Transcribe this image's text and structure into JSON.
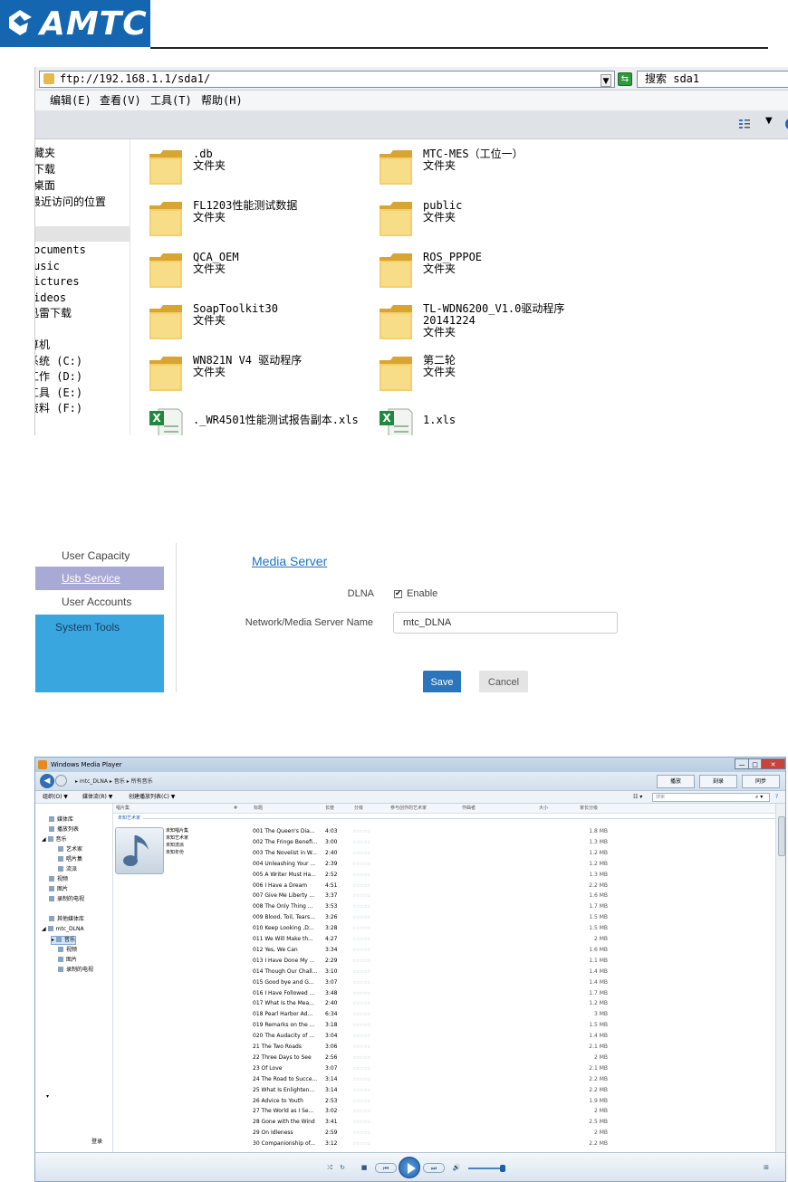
{
  "header": {
    "logo_text": "AMTC"
  },
  "ftp": {
    "address": "ftp://192.168.1.1/sda1/",
    "search": "搜索 sda1",
    "menus": [
      "编辑(E)",
      "查看(V)",
      "工具(T)",
      "帮助(H)"
    ],
    "nav_items": [
      "藏夹",
      "下载",
      "桌面",
      "最近访问的位置",
      "ocuments",
      "usic",
      "ictures",
      "ideos",
      "迅雷下载",
      "算机",
      "系统 (C:)",
      "工作 (D:)",
      "工具 (E:)",
      "资料 (F:)"
    ],
    "files": [
      {
        "name": ".db",
        "type": "文件夹",
        "kind": "folder"
      },
      {
        "name": "MTC-MES（工位一）",
        "type": "文件夹",
        "kind": "folder"
      },
      {
        "name": "FL1203性能测试数据",
        "type": "文件夹",
        "kind": "folder"
      },
      {
        "name": "public",
        "type": "文件夹",
        "kind": "folder"
      },
      {
        "name": "QCA_OEM",
        "type": "文件夹",
        "kind": "folder"
      },
      {
        "name": "ROS_PPPOE",
        "type": "文件夹",
        "kind": "folder"
      },
      {
        "name": "SoapToolkit30",
        "type": "文件夹",
        "kind": "folder"
      },
      {
        "name": "TL-WDN6200_V1.0驱动程序",
        "name2": "20141224",
        "type": "文件夹",
        "kind": "folder"
      },
      {
        "name": "WN821N V4 驱动程序",
        "type": "文件夹",
        "kind": "folder"
      },
      {
        "name": "第二轮",
        "type": "文件夹",
        "kind": "folder"
      },
      {
        "name": "._WR4501性能测试报告副本.xls",
        "type": "",
        "kind": "xls"
      },
      {
        "name": "1.xls",
        "type": "",
        "kind": "xls"
      }
    ]
  },
  "router": {
    "sidebar": [
      "User Capacity",
      "Usb Service",
      "User Accounts",
      "System Tools"
    ],
    "title": "Media Server",
    "dlna_label": "DLNA",
    "dlna_enabled": true,
    "enable_label": "Enable",
    "name_label": "Network/Media Server Name",
    "name_value": "mtc_DLNA",
    "save": "Save",
    "cancel": "Cancel",
    "colors": {
      "accent": "#2a75bc",
      "sidebar_active": "#a9a9d6",
      "sidebar_tools": "#3aa6e0"
    }
  },
  "wmp": {
    "title": "Windows Media Player",
    "window_buttons": [
      "minimize-icon",
      "maximize-icon",
      "close-icon"
    ],
    "breadcrumb": "▸  mtc_DLNA  ▸  音乐  ▸  所有音乐",
    "tabs": [
      "播放",
      "刻录",
      "同步"
    ],
    "commands": [
      "组织(O) ▼",
      "媒体流(R) ▼",
      "创建播放列表(C) ▼"
    ],
    "search_placeholder": "搜索",
    "columns": [
      "唱片集",
      "#",
      "标题",
      "长度",
      "分级",
      "参与创作的艺术家",
      "作曲者",
      "大小",
      "家长分级"
    ],
    "artist_group": "未知艺术家",
    "album_meta": [
      "未知唱片集",
      "未知艺术家",
      "未知流派",
      "未知年份"
    ],
    "left_nav": [
      "媒体库",
      "播放列表",
      "音乐",
      "艺术家",
      "唱片集",
      "流派",
      "视频",
      "图片",
      "录制的电视",
      "其他媒体库",
      "mtc_DLNA",
      "音乐",
      "视频",
      "图片",
      "录制的电视"
    ],
    "login": "登录",
    "rating_text": "☆☆☆☆☆",
    "tracks": [
      {
        "title": "001 The Queen's Dia...",
        "length": "4:03",
        "size": "1.8 MB"
      },
      {
        "title": "002 The Fringe Benefi...",
        "length": "3:00",
        "size": "1.3 MB"
      },
      {
        "title": "003 The Novelist in W...",
        "length": "2:40",
        "size": "1.2 MB"
      },
      {
        "title": "004 Unleashing Your ...",
        "length": "2:39",
        "size": "1.2 MB"
      },
      {
        "title": "005 A Writer Must Ha...",
        "length": "2:52",
        "size": "1.3 MB"
      },
      {
        "title": "006 I Have a Dream",
        "length": "4:51",
        "size": "2.2 MB"
      },
      {
        "title": "007 Give Me Liberty ...",
        "length": "3:37",
        "size": "1.6 MB"
      },
      {
        "title": "008 The Only Thing ...",
        "length": "3:53",
        "size": "1.7 MB"
      },
      {
        "title": "009 Blood, Toil, Tears...",
        "length": "3:26",
        "size": "1.5 MB"
      },
      {
        "title": "010 Keep Looking ,D...",
        "length": "3:28",
        "size": "1.5 MB"
      },
      {
        "title": "011 We Will Make th...",
        "length": "4:27",
        "size": "2 MB"
      },
      {
        "title": "012 Yes, We Can",
        "length": "3:34",
        "size": "1.6 MB"
      },
      {
        "title": "013 I Have Done My ...",
        "length": "2:29",
        "size": "1.1 MB"
      },
      {
        "title": "014 Though Our Chall...",
        "length": "3:10",
        "size": "1.4 MB"
      },
      {
        "title": "015 Good bye and G...",
        "length": "3:07",
        "size": "1.4 MB"
      },
      {
        "title": "016 I Have Followed ...",
        "length": "3:48",
        "size": "1.7 MB"
      },
      {
        "title": "017 What Is the Mea...",
        "length": "2:40",
        "size": "1.2 MB"
      },
      {
        "title": "018 Pearl Harbor Ad...",
        "length": "6:34",
        "size": "3 MB"
      },
      {
        "title": "019 Remarks on the ...",
        "length": "3:18",
        "size": "1.5 MB"
      },
      {
        "title": "020 The Audacity of ...",
        "length": "3:04",
        "size": "1.4 MB"
      },
      {
        "title": "21 The Two Roads",
        "length": "3:06",
        "size": "2.1 MB"
      },
      {
        "title": "22 Three Days to See",
        "length": "2:56",
        "size": "2 MB"
      },
      {
        "title": "23 Of Love",
        "length": "3:07",
        "size": "2.1 MB"
      },
      {
        "title": "24 The Road to Succe...",
        "length": "3:14",
        "size": "2.2 MB"
      },
      {
        "title": "25 What Is Enlighten...",
        "length": "3:14",
        "size": "2.2 MB"
      },
      {
        "title": "26 Advice to Youth",
        "length": "2:53",
        "size": "1.9 MB"
      },
      {
        "title": "27 The World as I Se...",
        "length": "3:02",
        "size": "2 MB"
      },
      {
        "title": "28 Gone with the Wind",
        "length": "3:41",
        "size": "2.5 MB"
      },
      {
        "title": "29 On Idleness",
        "length": "2:59",
        "size": "2 MB"
      },
      {
        "title": "30 Companionship of...",
        "length": "3:12",
        "size": "2.2 MB"
      }
    ]
  }
}
